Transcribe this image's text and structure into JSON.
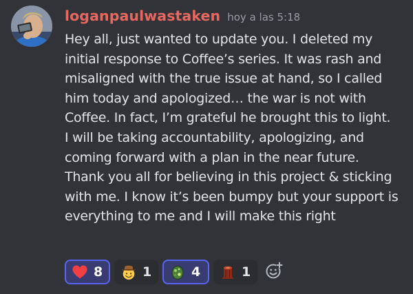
{
  "message": {
    "username": "loganpaulwastaken",
    "timestamp": "hoy a las 5:18",
    "lines": [
      "Hey all, just wanted to update you. I deleted my",
      "initial response to Coffee’s series. It was rash and",
      "misaligned with the true issue at hand, so I called",
      "him today and apologized… the war is not with",
      "Coffee. In fact, I’m grateful he brought this to light.",
      "I will be taking accountability, apologizing, and",
      "coming forward with a plan in the near future.",
      "Thank you all for believing in this project & sticking",
      "with me. I know it’s been bumpy but your support is",
      "everything to me and I will make this right"
    ],
    "username_color": "#e8675f"
  },
  "reactions": [
    {
      "emoji": "heart-icon",
      "count": "8",
      "active": true
    },
    {
      "emoji": "cowboy-face-icon",
      "count": "1",
      "active": false
    },
    {
      "emoji": "cryptozoo-egg-icon",
      "count": "4",
      "active": true
    },
    {
      "emoji": "tree-stump-icon",
      "count": "1",
      "active": false
    }
  ],
  "add_reaction": {
    "icon": "add-reaction-icon"
  },
  "colors": {
    "background": "#313338",
    "active_reaction_bg": "#383c71",
    "active_reaction_border": "#5865f2"
  }
}
